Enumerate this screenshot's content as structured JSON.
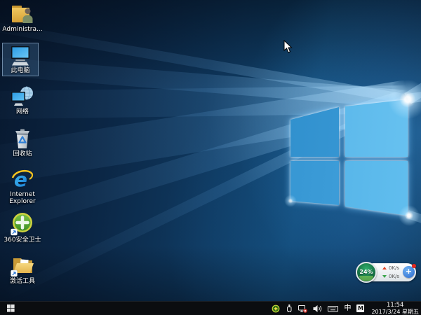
{
  "desktop_icons": [
    {
      "name": "user-folder",
      "label": "Administra..."
    },
    {
      "name": "this-pc",
      "label": "此电脑",
      "selected": true
    },
    {
      "name": "network",
      "label": "网络"
    },
    {
      "name": "recycle-bin",
      "label": "回收站"
    },
    {
      "name": "internet-explorer",
      "label": "Internet Explorer"
    },
    {
      "name": "360-safe",
      "label": "360安全卫士"
    },
    {
      "name": "activation-tool",
      "label": "激活工具"
    }
  ],
  "widget": {
    "percent": "24%",
    "up_label": "0K/s",
    "down_label": "0K/s",
    "plus": "+"
  },
  "taskbar": {
    "start_icon": "windows-logo",
    "tray_icon_names": [
      "360-tray-icon",
      "usb-device-icon",
      "network-disconnected-icon",
      "volume-icon",
      "keyboard-icon"
    ],
    "ime_mode": "中",
    "ime_badge": "M",
    "time": "11:54",
    "date": "2017/3/24 星期五"
  },
  "colors": {
    "wallpaper_dark": "#0a2440",
    "wallpaper_accent": "#2e8fd0",
    "taskbar": "#0b0d10",
    "widget_green": "#1f7a4a",
    "widget_blue": "#2a69cf",
    "alert_red": "#e8281e"
  }
}
